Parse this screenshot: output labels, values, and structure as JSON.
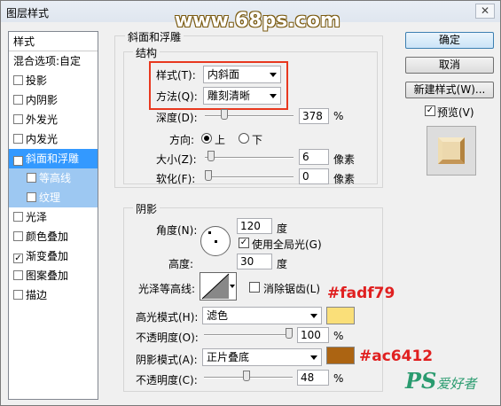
{
  "window": {
    "title": "图层样式",
    "close_glyph": "✕"
  },
  "watermark": "www.68ps.com",
  "left_panel": {
    "header": "样式",
    "blend_options": "混合选项:自定",
    "items": [
      {
        "label": "投影",
        "checked": false
      },
      {
        "label": "内阴影",
        "checked": false
      },
      {
        "label": "外发光",
        "checked": false
      },
      {
        "label": "内发光",
        "checked": false
      },
      {
        "label": "斜面和浮雕",
        "checked": true
      },
      {
        "label": "等高线",
        "checked": false
      },
      {
        "label": "纹理",
        "checked": false
      },
      {
        "label": "光泽",
        "checked": false
      },
      {
        "label": "颜色叠加",
        "checked": false
      },
      {
        "label": "渐变叠加",
        "checked": true
      },
      {
        "label": "图案叠加",
        "checked": false
      },
      {
        "label": "描边",
        "checked": false
      }
    ]
  },
  "bevel": {
    "group_title": "斜面和浮雕",
    "structure_title": "结构",
    "style_label": "样式(T):",
    "style_value": "内斜面",
    "technique_label": "方法(Q):",
    "technique_value": "雕刻清晰",
    "depth_label": "深度(D):",
    "depth_value": "378",
    "depth_unit": "%",
    "depth_level": 0.2,
    "direction_label": "方向:",
    "dir_up": "上",
    "dir_down": "下",
    "size_label": "大小(Z):",
    "size_value": "6",
    "size_unit": "像素",
    "size_level": 0.03,
    "soften_label": "软化(F):",
    "soften_value": "0",
    "soften_unit": "像素",
    "soften_level": 0
  },
  "shading": {
    "title": "阴影",
    "angle_label": "角度(N):",
    "angle_value": "120",
    "angle_unit": "度",
    "global_light_label": "使用全局光(G)",
    "altitude_label": "高度:",
    "altitude_value": "30",
    "altitude_unit": "度",
    "gloss_label": "光泽等高线:",
    "antialias_label": "消除锯齿(L)",
    "highlight_mode_label": "高光模式(H):",
    "highlight_mode": "滤色",
    "highlight_color": "#fadf79",
    "highlight_opacity_label": "不透明度(O):",
    "highlight_opacity": "100",
    "highlight_opacity_level": 1.0,
    "shadow_mode_label": "阴影模式(A):",
    "shadow_mode": "正片叠底",
    "shadow_color": "#ac6412",
    "shadow_opacity_label": "不透明度(C):",
    "shadow_opacity": "48",
    "shadow_opacity_level": 0.48,
    "pct": "%"
  },
  "annotations": {
    "highlight": "#fadf79",
    "shadow": "#ac6412"
  },
  "buttons": {
    "ok": "确定",
    "cancel": "取消",
    "new_style": "新建样式(W)...",
    "preview": "预览(V)"
  },
  "brand": {
    "logo": "PS",
    "text": "爱好者"
  }
}
